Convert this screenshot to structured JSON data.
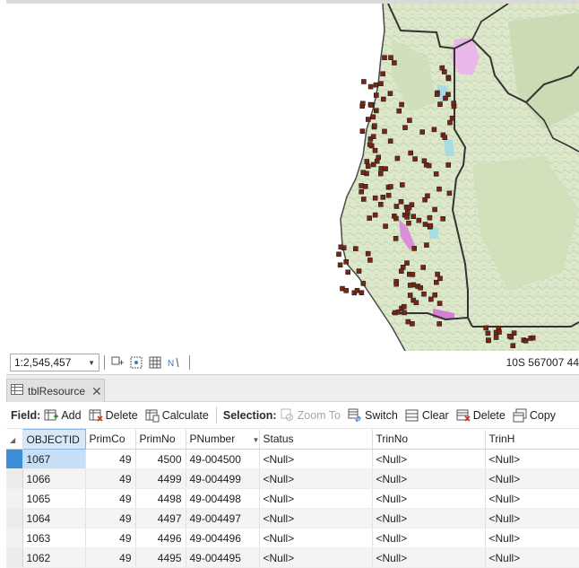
{
  "map": {
    "scale_value": "1:2,545,457",
    "coordinates": "10S 567007 44"
  },
  "table": {
    "tab_label": "tblResource",
    "field_group_label": "Field:",
    "field_commands": {
      "add": "Add",
      "delete": "Delete",
      "calculate": "Calculate"
    },
    "selection_group_label": "Selection:",
    "selection_commands": {
      "zoom_to": "Zoom To",
      "switch": "Switch",
      "clear": "Clear",
      "delete": "Delete",
      "copy": "Copy"
    },
    "columns": [
      "OBJECTID",
      "PrimCo",
      "PrimNo",
      "PNumber",
      "Status",
      "TrinNo",
      "TrinH"
    ],
    "rows": [
      [
        "1067",
        "49",
        "4500",
        "49-004500",
        "<Null>",
        "<Null>",
        "<Null>"
      ],
      [
        "1066",
        "49",
        "4499",
        "49-004499",
        "<Null>",
        "<Null>",
        "<Null>"
      ],
      [
        "1065",
        "49",
        "4498",
        "49-004498",
        "<Null>",
        "<Null>",
        "<Null>"
      ],
      [
        "1064",
        "49",
        "4497",
        "49-004497",
        "<Null>",
        "<Null>",
        "<Null>"
      ],
      [
        "1063",
        "49",
        "4496",
        "49-004496",
        "<Null>",
        "<Null>",
        "<Null>"
      ],
      [
        "1062",
        "49",
        "4495",
        "49-004495",
        "<Null>",
        "<Null>",
        "<Null>"
      ]
    ]
  },
  "colors": {
    "land": "#dfe8cf",
    "forest": "#b9d3a0",
    "boundary": "#333333",
    "point_fill": "#7a2512",
    "wetland": "#a8d8e0",
    "park": "#e8b6e8",
    "selected_row": "#c6dff7"
  }
}
